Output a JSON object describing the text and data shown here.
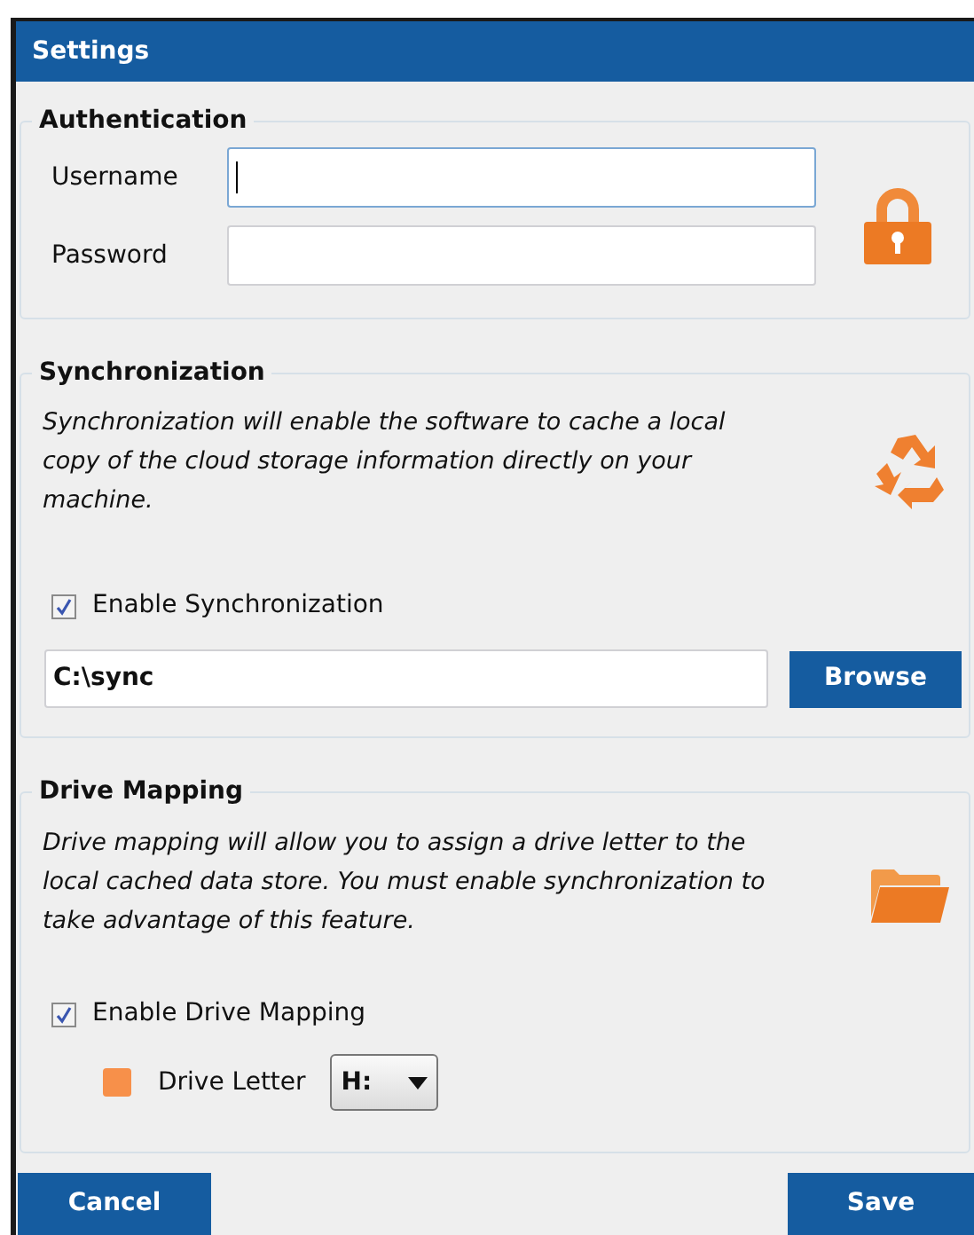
{
  "window": {
    "title": "Settings"
  },
  "authentication": {
    "title": "Authentication",
    "fields": [
      {
        "label": "Username",
        "focused": true
      },
      {
        "label": "Password",
        "focused": false
      }
    ]
  },
  "synchronization": {
    "title": "Synchronization",
    "description": "Synchronization will enable the software to cache a local copy of the cloud storage information directly on your machine.",
    "checkbox": {
      "label": "Enable Synchronization",
      "checked": true
    },
    "path": {
      "value": "C:\\sync"
    },
    "browse_button": "Browse"
  },
  "drive_mapping": {
    "title": "Drive Mapping",
    "description": "Drive mapping will allow you to assign a drive letter to the local cached data store. You must enable synchronization to take advantage of this feature.",
    "checkbox": {
      "label": "Enable Drive Mapping",
      "checked": true
    },
    "drive_letter": {
      "label": "Drive Letter",
      "value": "H:"
    }
  },
  "buttons": [
    "Cancel",
    "Save"
  ]
}
